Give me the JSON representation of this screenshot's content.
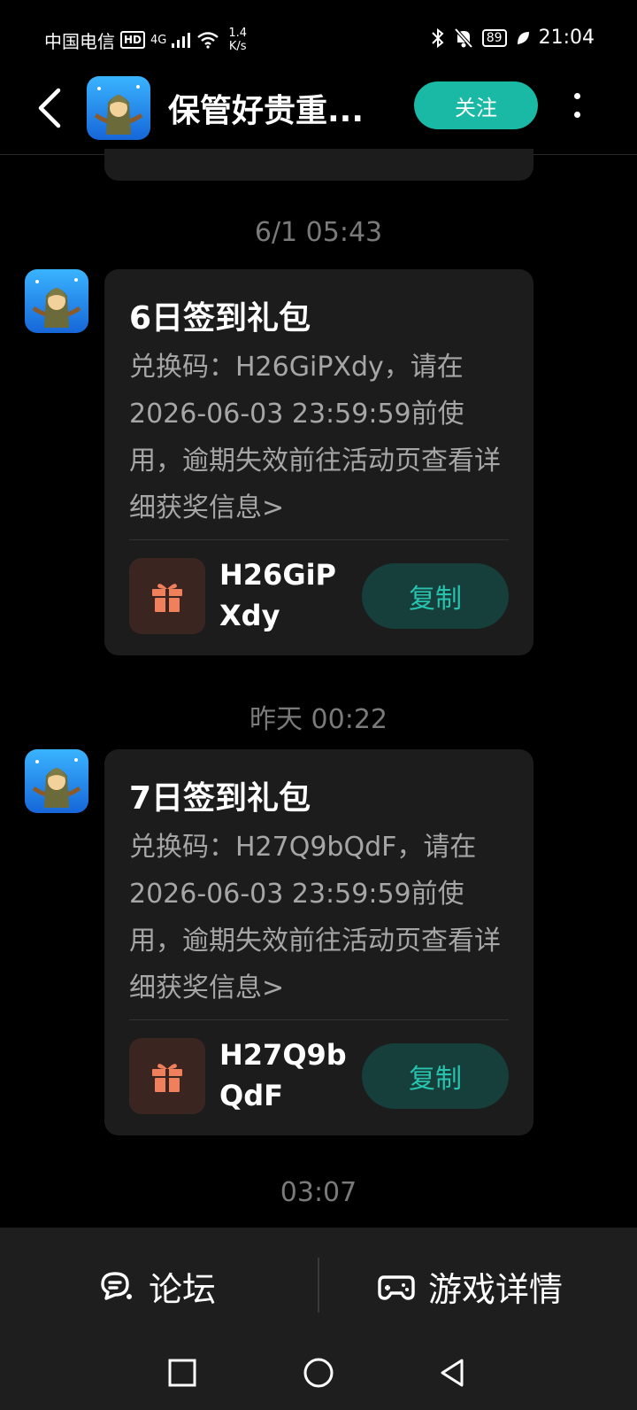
{
  "status_bar": {
    "carrier": "中国电信",
    "hd": "HD",
    "network": "4G",
    "speed_value": "1.4",
    "speed_unit": "K/s",
    "battery": "89",
    "time": "21:04"
  },
  "header": {
    "title": "保管好贵重...",
    "follow_label": "关注"
  },
  "messages": [
    {
      "timestamp": "6/1  05:43",
      "title": "6日签到礼包",
      "body": "兑换码：H26GiPXdy，请在2026-06-03 23:59:59前使用，逾期失效前往活动页查看详细获奖信息>",
      "code": "H26GiPXdy",
      "copy_label": "复制"
    },
    {
      "timestamp": "昨天  00:22",
      "title": "7日签到礼包",
      "body": "兑换码：H27Q9bQdF，请在2026-06-03 23:59:59前使用，逾期失效前往活动页查看详细获奖信息>",
      "code": "H27Q9bQdF",
      "copy_label": "复制"
    }
  ],
  "last_timestamp": "03:07",
  "bottom_bar": {
    "forum_label": "论坛",
    "game_details_label": "游戏详情"
  },
  "colors": {
    "accent": "#1ab9a5",
    "copy_text": "#27c3ae",
    "gift_icon": "#f07f5c"
  }
}
